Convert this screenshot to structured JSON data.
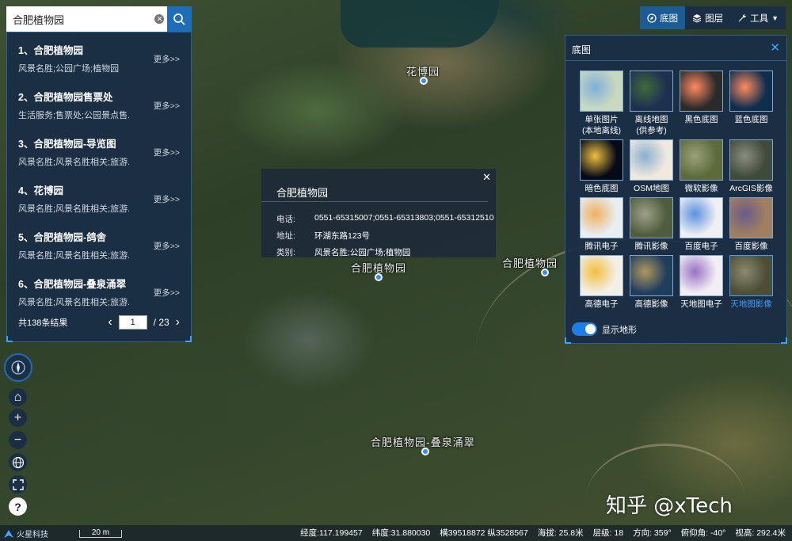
{
  "search": {
    "value": "合肥植物园"
  },
  "results": {
    "items": [
      {
        "title": "1、合肥植物园",
        "sub": "风景名胜;公园广场;植物园",
        "more": "更多>>"
      },
      {
        "title": "2、合肥植物园售票处",
        "sub": "生活服务;售票处;公园景点售...",
        "more": "更多>>"
      },
      {
        "title": "3、合肥植物园-导览图",
        "sub": "风景名胜;风景名胜相关;旅游...",
        "more": "更多>>"
      },
      {
        "title": "4、花博园",
        "sub": "风景名胜;风景名胜相关;旅游...",
        "more": "更多>>"
      },
      {
        "title": "5、合肥植物园-鸽舍",
        "sub": "风景名胜;风景名胜相关;旅游...",
        "more": "更多>>"
      },
      {
        "title": "6、合肥植物园-叠泉涌翠",
        "sub": "风景名胜;风景名胜相关;旅游...",
        "more": "更多>>"
      }
    ],
    "total": "共138条结果",
    "page": "1",
    "pages": "/ 23",
    "prev": "‹",
    "next": "›"
  },
  "popup": {
    "title": "合肥植物园",
    "close": "✕",
    "rows": [
      {
        "k": "电话:",
        "v": "0551-65315007;0551-65313803;0551-65312510"
      },
      {
        "k": "地址:",
        "v": "环湖东路123号"
      },
      {
        "k": "类别:",
        "v": "风景名胜;公园广场;植物园"
      }
    ]
  },
  "toolbar": {
    "basemap": "底图",
    "layers": "图层",
    "tools": "工具"
  },
  "basemap_panel": {
    "title": "底图",
    "close": "✕",
    "tiles": [
      {
        "label": "单张图片\n(本地离线)",
        "color": "#c9d8c0",
        "accent": "#7fb0d8",
        "selected": false
      },
      {
        "label": "离线地图\n(供参考)",
        "color": "#1e3050",
        "accent": "#3f6a3a",
        "selected": false
      },
      {
        "label": "黑色底图",
        "color": "#2a2a2a",
        "accent": "#ff8a60",
        "selected": false
      },
      {
        "label": "蓝色底图",
        "color": "#0f2e4e",
        "accent": "#ff8a60",
        "selected": false
      },
      {
        "label": "暗色底图",
        "color": "#050a18",
        "accent": "#f0c040",
        "selected": false
      },
      {
        "label": "OSM地图",
        "color": "#efe9df",
        "accent": "#8ab0d0",
        "selected": false
      },
      {
        "label": "微软影像",
        "color": "#5d6b3b",
        "accent": "#9aa07a",
        "selected": false
      },
      {
        "label": "ArcGIS影像",
        "color": "#3e4a3a",
        "accent": "#8a8d80",
        "selected": false
      },
      {
        "label": "腾讯电子",
        "color": "#e8eef2",
        "accent": "#f0b060",
        "selected": false
      },
      {
        "label": "腾讯影像",
        "color": "#4f5d3c",
        "accent": "#9da08a",
        "selected": false
      },
      {
        "label": "百度电子",
        "color": "#eef0f3",
        "accent": "#5a8fe0",
        "selected": false
      },
      {
        "label": "百度影像",
        "color": "#a08060",
        "accent": "#6b5a8a",
        "selected": false
      },
      {
        "label": "高德电子",
        "color": "#f2efe8",
        "accent": "#f2c040",
        "selected": false
      },
      {
        "label": "高德影像",
        "color": "#1f3e5e",
        "accent": "#b09860",
        "selected": false
      },
      {
        "label": "天地图电子",
        "color": "#f3eef5",
        "accent": "#9a70c0",
        "selected": false
      },
      {
        "label": "天地图影像",
        "color": "#4c4e36",
        "accent": "#8c8a70",
        "selected": true
      }
    ],
    "terrain_label": "显示地形"
  },
  "map_labels": [
    {
      "text": "花博园"
    },
    {
      "text": "合肥植物园"
    },
    {
      "text": "合肥植物园"
    },
    {
      "text": "合肥植物园-叠泉涌翠"
    }
  ],
  "controls": {
    "home": "⌂",
    "zoom_in": "+",
    "zoom_out": "−",
    "help": "?"
  },
  "status": {
    "logo": "火星科技",
    "scale": "20 m",
    "lon": "经度:117.199457",
    "lat": "纬度:31.880030",
    "proj": "横39518872 纵3528567",
    "alt": "海拔: 25.8米",
    "level": "层级: 18",
    "heading": "方向: 359°",
    "pitch": "俯仰角: -40°",
    "view_height": "视高: 292.4米"
  },
  "watermark": "知乎 @xTech"
}
